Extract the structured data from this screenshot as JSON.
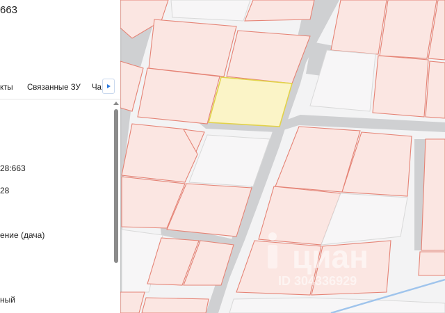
{
  "panel": {
    "title": "663",
    "tabs": [
      {
        "label": "кты"
      },
      {
        "label": "Связанные ЗУ"
      },
      {
        "label": "Ча"
      }
    ],
    "fields": [
      {
        "value": "28:663"
      },
      {
        "value": "28"
      },
      {
        "value": "ение (дача)"
      },
      {
        "value": "ный"
      }
    ]
  },
  "map": {
    "watermark_brand": "циан",
    "watermark_id": "ID 304336929"
  },
  "colors": {
    "parcel_fill": "#fbe6e2",
    "parcel_stroke": "#e58375",
    "road": "#cfd0d2",
    "selected_fill": "#fbf4c7",
    "selected_stroke": "#e2d24a",
    "accent": "#2d7be0"
  }
}
